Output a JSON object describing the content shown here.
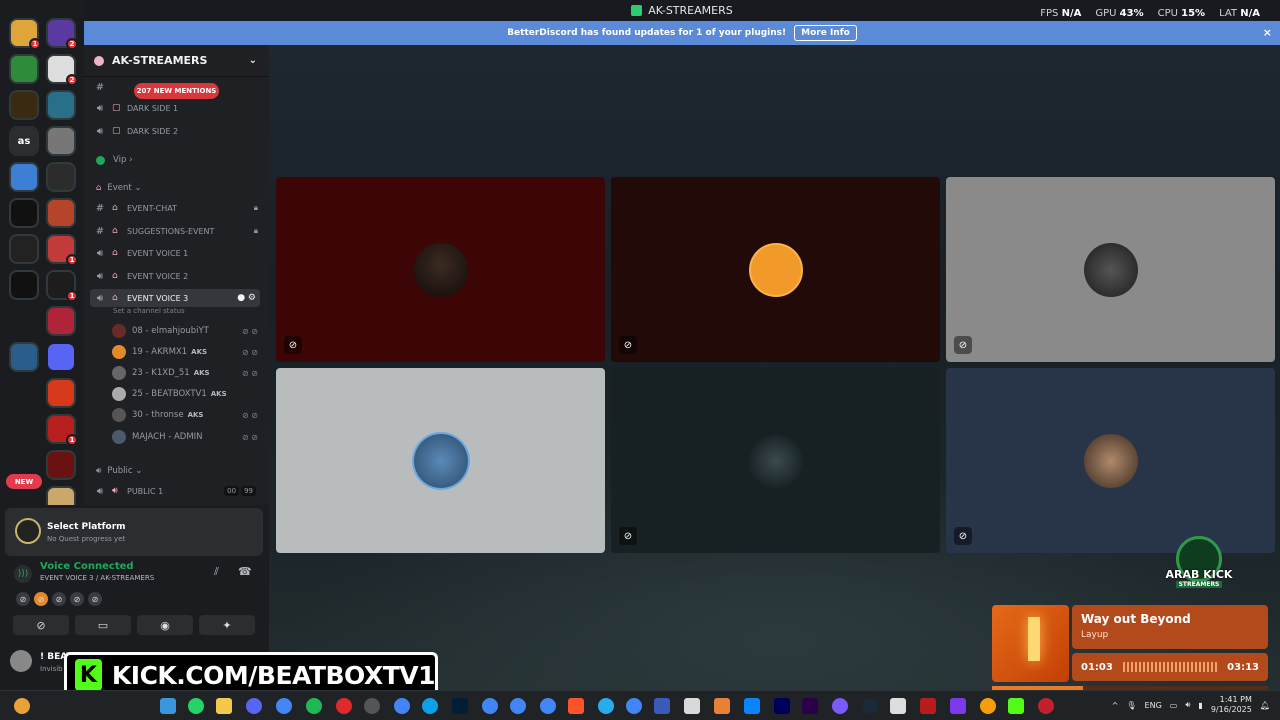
{
  "window": {
    "title": "AK-STREAMERS"
  },
  "perf": {
    "fps_label": "FPS",
    "fps_value": "N/A",
    "gpu_label": "GPU",
    "gpu_value": "43%",
    "cpu_label": "CPU",
    "cpu_value": "15%",
    "lat_label": "LAT",
    "lat_value": "N/A"
  },
  "notice": {
    "text": "BetterDiscord has found updates for 1 of your plugins!",
    "button": "More Info",
    "close": "×"
  },
  "rail": {
    "new_label": "NEW",
    "initials": "as",
    "badges": [
      "1",
      "2",
      "2",
      "1",
      "1",
      "1"
    ]
  },
  "server": {
    "name": "AK-STREAMERS",
    "mentions": "207 NEW MENTIONS",
    "channels": {
      "dark1": "DARK SIDE 1",
      "dark2": "DARK SIDE 2",
      "vip": "Vip",
      "event_cat": "Event",
      "event_chat": "EVENT-CHAT",
      "suggestions": "SUGGESTIONS-EVENT",
      "ev1": "EVENT VOICE 1",
      "ev2": "EVENT VOICE 2",
      "ev3": "EVENT VOICE 3",
      "ev3_status": "Set a channel status",
      "public_cat": "Public",
      "public1": "PUBLIC 1",
      "public1_count_a": "00",
      "public1_count_b": "99"
    },
    "voice_users": [
      {
        "name": "08 - elmahjoubiYT",
        "tag": ""
      },
      {
        "name": "19 - AKRMX1",
        "tag": "AKS"
      },
      {
        "name": "23 - K1XD_51",
        "tag": "AKS"
      },
      {
        "name": "25 - BEATBOXTV1",
        "tag": "AKS"
      },
      {
        "name": "30 - thronse",
        "tag": "AKS"
      },
      {
        "name": "MAJACH - ADMIN",
        "tag": ""
      }
    ]
  },
  "quest": {
    "title": "Select Platform",
    "sub": "No Quest progress yet"
  },
  "voice": {
    "status": "Voice Connected",
    "channel": "EVENT VOICE 3 / AK-STREAMERS"
  },
  "me": {
    "name": "! BEAT",
    "status": "Invisib"
  },
  "kick": {
    "url": "KICK.COM/BEATBOXTV1",
    "logo": "K"
  },
  "arab": {
    "line1": "ARAB KICK",
    "line2": "STREAMERS"
  },
  "music": {
    "title": "Way out Beyond",
    "artist": "Layup",
    "elapsed": "01:03",
    "total": "03:13",
    "progress": 0.33
  },
  "tray": {
    "lang": "ENG",
    "time": "1:41 PM",
    "date": "9/16/2025",
    "chevron": "^"
  },
  "colors": {
    "accent": "#5b8ad9",
    "voice_green": "#23a55a",
    "mention_red": "#da373c",
    "kick_green": "#53fc18"
  }
}
